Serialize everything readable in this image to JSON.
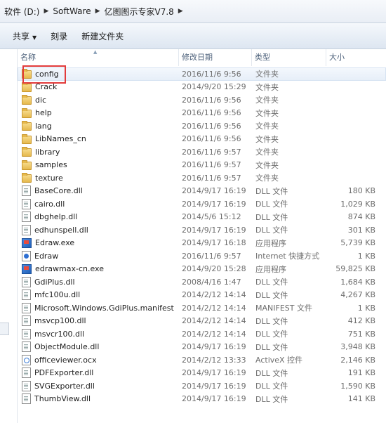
{
  "breadcrumb": {
    "items": [
      "软件 (D:)",
      "SoftWare",
      "亿图图示专家V7.8"
    ],
    "separator": "▶"
  },
  "toolbar": {
    "share_label": "共享",
    "burn_label": "刻录",
    "new_folder_label": "新建文件夹"
  },
  "columns": {
    "name": "名称",
    "date": "修改日期",
    "type": "类型",
    "size": "大小"
  },
  "files": [
    {
      "name": "config",
      "date": "2016/11/6 9:56",
      "type": "文件夹",
      "size": "",
      "icon": "folder-icon",
      "selected": true
    },
    {
      "name": "Crack",
      "date": "2014/9/20 15:29",
      "type": "文件夹",
      "size": "",
      "icon": "folder-icon"
    },
    {
      "name": "dic",
      "date": "2016/11/6 9:56",
      "type": "文件夹",
      "size": "",
      "icon": "folder-icon"
    },
    {
      "name": "help",
      "date": "2016/11/6 9:56",
      "type": "文件夹",
      "size": "",
      "icon": "folder-icon"
    },
    {
      "name": "lang",
      "date": "2016/11/6 9:56",
      "type": "文件夹",
      "size": "",
      "icon": "folder-icon"
    },
    {
      "name": "LibNames_cn",
      "date": "2016/11/6 9:56",
      "type": "文件夹",
      "size": "",
      "icon": "folder-icon"
    },
    {
      "name": "library",
      "date": "2016/11/6 9:57",
      "type": "文件夹",
      "size": "",
      "icon": "folder-icon"
    },
    {
      "name": "samples",
      "date": "2016/11/6 9:57",
      "type": "文件夹",
      "size": "",
      "icon": "folder-icon"
    },
    {
      "name": "texture",
      "date": "2016/11/6 9:57",
      "type": "文件夹",
      "size": "",
      "icon": "folder-icon"
    },
    {
      "name": "BaseCore.dll",
      "date": "2014/9/17 16:19",
      "type": "DLL 文件",
      "size": "180 KB",
      "icon": "dll-file-icon"
    },
    {
      "name": "cairo.dll",
      "date": "2014/9/17 16:19",
      "type": "DLL 文件",
      "size": "1,029 KB",
      "icon": "dll-file-icon"
    },
    {
      "name": "dbghelp.dll",
      "date": "2014/5/6 15:12",
      "type": "DLL 文件",
      "size": "874 KB",
      "icon": "dll-file-icon"
    },
    {
      "name": "edhunspell.dll",
      "date": "2014/9/17 16:19",
      "type": "DLL 文件",
      "size": "301 KB",
      "icon": "dll-file-icon"
    },
    {
      "name": "Edraw.exe",
      "date": "2014/9/17 16:18",
      "type": "应用程序",
      "size": "5,739 KB",
      "icon": "exe-icon"
    },
    {
      "name": "Edraw",
      "date": "2016/11/6 9:57",
      "type": "Internet 快捷方式",
      "size": "1 KB",
      "icon": "internet-shortcut-icon"
    },
    {
      "name": "edrawmax-cn.exe",
      "date": "2014/9/20 15:28",
      "type": "应用程序",
      "size": "59,825 KB",
      "icon": "exe-icon"
    },
    {
      "name": "GdiPlus.dll",
      "date": "2008/4/16 1:47",
      "type": "DLL 文件",
      "size": "1,684 KB",
      "icon": "dll-file-icon"
    },
    {
      "name": "mfc100u.dll",
      "date": "2014/2/12 14:14",
      "type": "DLL 文件",
      "size": "4,267 KB",
      "icon": "dll-file-icon"
    },
    {
      "name": "Microsoft.Windows.GdiPlus.manifest",
      "date": "2014/2/12 14:14",
      "type": "MANIFEST 文件",
      "size": "1 KB",
      "icon": "manifest-file-icon"
    },
    {
      "name": "msvcp100.dll",
      "date": "2014/2/12 14:14",
      "type": "DLL 文件",
      "size": "412 KB",
      "icon": "dll-file-icon"
    },
    {
      "name": "msvcr100.dll",
      "date": "2014/2/12 14:14",
      "type": "DLL 文件",
      "size": "751 KB",
      "icon": "dll-file-icon"
    },
    {
      "name": "ObjectModule.dll",
      "date": "2014/9/17 16:19",
      "type": "DLL 文件",
      "size": "3,948 KB",
      "icon": "dll-file-icon"
    },
    {
      "name": "officeviewer.ocx",
      "date": "2014/2/12 13:33",
      "type": "ActiveX 控件",
      "size": "2,146 KB",
      "icon": "ocx-file-icon"
    },
    {
      "name": "PDFExporter.dll",
      "date": "2014/9/17 16:19",
      "type": "DLL 文件",
      "size": "191 KB",
      "icon": "dll-file-icon"
    },
    {
      "name": "SVGExporter.dll",
      "date": "2014/9/17 16:19",
      "type": "DLL 文件",
      "size": "1,590 KB",
      "icon": "dll-file-icon"
    },
    {
      "name": "ThumbView.dll",
      "date": "2014/9/17 16:19",
      "type": "DLL 文件",
      "size": "141 KB",
      "icon": "dll-file-icon"
    }
  ],
  "colors": {
    "selection_outline": "#e23b3b",
    "folder": "#e6b94d",
    "header_text": "#4c607a"
  }
}
